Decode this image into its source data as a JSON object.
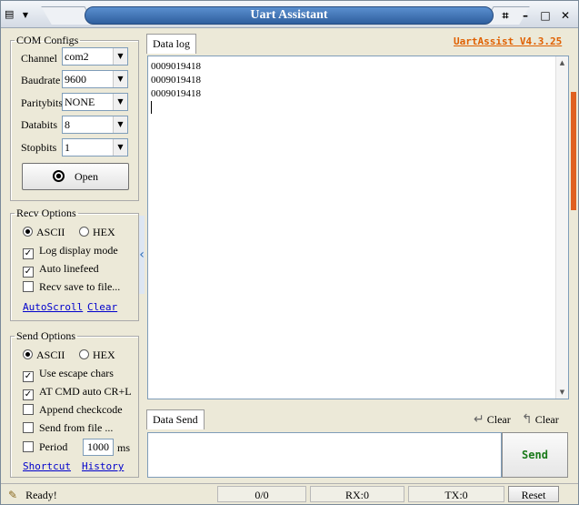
{
  "window": {
    "title": "Uart Assistant"
  },
  "com_configs": {
    "title": "COM Configs",
    "channel": {
      "label": "Channel",
      "value": "com2"
    },
    "baudrate": {
      "label": "Baudrate",
      "value": "9600"
    },
    "paritybits": {
      "label": "Paritybits",
      "value": "NONE"
    },
    "databits": {
      "label": "Databits",
      "value": "8"
    },
    "stopbits": {
      "label": "Stopbits",
      "value": "1"
    },
    "open_button": "Open"
  },
  "recv_options": {
    "title": "Recv Options",
    "ascii": "ASCII",
    "hex": "HEX",
    "log_display_mode": "Log display mode",
    "auto_linefeed": "Auto linefeed",
    "recv_save_to_file": "Recv save to file...",
    "autoscroll_link": "AutoScroll",
    "clear_link": "Clear"
  },
  "send_options": {
    "title": "Send Options",
    "ascii": "ASCII",
    "hex": "HEX",
    "use_escape_chars": "Use escape chars",
    "at_cmd": "AT CMD auto CR+L",
    "append_checkcode": "Append checkcode",
    "send_from_file": "Send from file ...",
    "period_label": "Period",
    "period_value": "1000",
    "period_unit": "ms",
    "shortcut_link": "Shortcut",
    "history_link": "History"
  },
  "data_log": {
    "tab": "Data log",
    "version": "UartAssist V4.3.25",
    "lines": [
      "0009019418",
      "0009019418",
      "0009019418"
    ]
  },
  "data_send": {
    "tab": "Data Send",
    "clear1": "Clear",
    "clear2": "Clear",
    "send_button": "Send"
  },
  "status": {
    "ready": "Ready!",
    "counter": "0/0",
    "rx": "RX:0",
    "tx": "TX:0",
    "reset": "Reset"
  }
}
